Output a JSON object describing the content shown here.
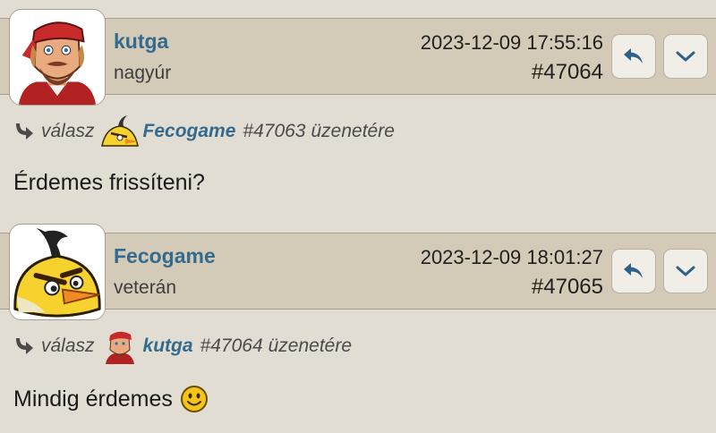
{
  "posts": [
    {
      "username": "kutga",
      "rank": "nagyúr",
      "date": "2023-12-09 17:55:16",
      "post_number": "#47064",
      "reply_to": {
        "prefix": "válasz",
        "user": "Fecogame",
        "post": "#47063",
        "suffix": "üzenetére"
      },
      "message": "Érdemes frissíteni?"
    },
    {
      "username": "Fecogame",
      "rank": "veterán",
      "date": "2023-12-09 18:01:27",
      "post_number": "#47065",
      "reply_to": {
        "prefix": "válasz",
        "user": "kutga",
        "post": "#47064",
        "suffix": "üzenetére"
      },
      "message": "Mindig érdemes"
    }
  ],
  "icons": {
    "reply": "reply-arrow-icon",
    "more": "chevron-down-icon",
    "reply_indicator": "curved-arrow-icon",
    "smiley": "smiley-icon"
  },
  "colors": {
    "username": "#336a8e",
    "header_bg": "#d3cab7",
    "page_bg": "#e2ddd3"
  }
}
